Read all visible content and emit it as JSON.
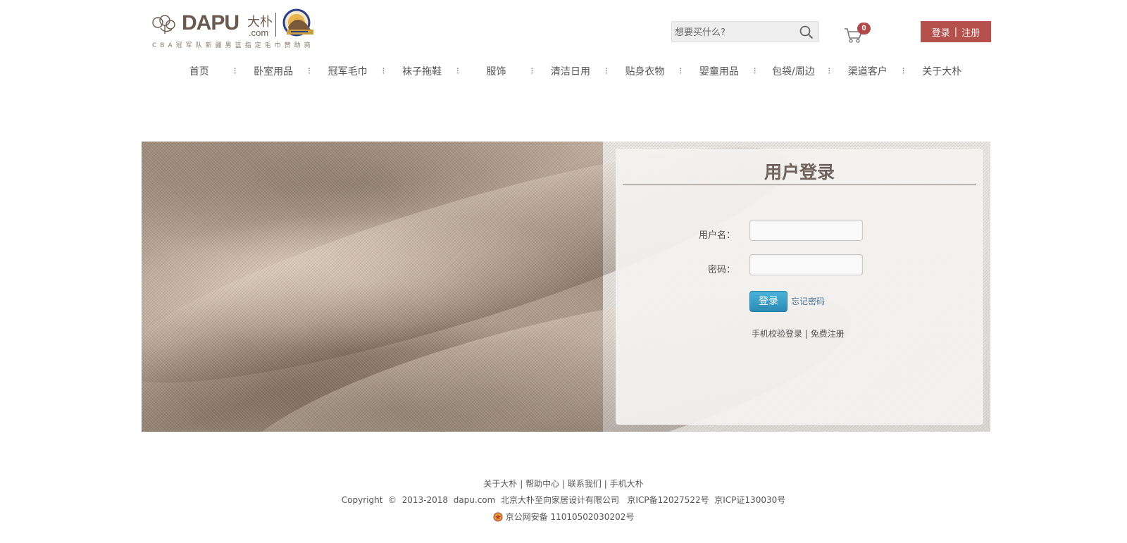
{
  "logo": {
    "brand": "DAPU",
    "brand_cn": "大朴",
    "domain": ".com",
    "tagline": "CBA冠军队新疆男篮指定毛巾赞助商"
  },
  "search": {
    "placeholder": "想要买什么?"
  },
  "cart": {
    "count": "0"
  },
  "auth": {
    "login": "登录",
    "separator": "|",
    "register": "注册"
  },
  "nav": {
    "items": [
      {
        "label": "首页"
      },
      {
        "label": "卧室用品"
      },
      {
        "label": "冠军毛巾"
      },
      {
        "label": "袜子拖鞋"
      },
      {
        "label": "服饰"
      },
      {
        "label": "清洁日用"
      },
      {
        "label": "贴身衣物"
      },
      {
        "label": "婴童用品"
      },
      {
        "label": "包袋/周边"
      },
      {
        "label": "渠道客户"
      },
      {
        "label": "关于大朴"
      }
    ]
  },
  "login_panel": {
    "title": "用户登录",
    "username_label": "用户名：",
    "password_label": "密码：",
    "submit": "登录",
    "forgot": "忘记密码",
    "phone_login": "手机校验登录",
    "separator": "|",
    "free_register": "免费注册"
  },
  "footer": {
    "links": [
      {
        "label": "关于大朴"
      },
      {
        "label": "帮助中心"
      },
      {
        "label": "联系我们"
      },
      {
        "label": "手机大朴"
      }
    ],
    "separator": "|",
    "copyright": "Copyright  ©  2013-2018  dapu.com  北京大朴至向家居设计有限公司   京ICP备12027522号  京ICP证130030号",
    "police": "京公网安备 11010502030202号"
  },
  "colors": {
    "brand_brown": "#6b5a4e",
    "auth_red": "#b5504c",
    "badge_red": "#b24a4a",
    "button_blue": "#2b8bb6",
    "link_blue": "#4b7a9c"
  }
}
